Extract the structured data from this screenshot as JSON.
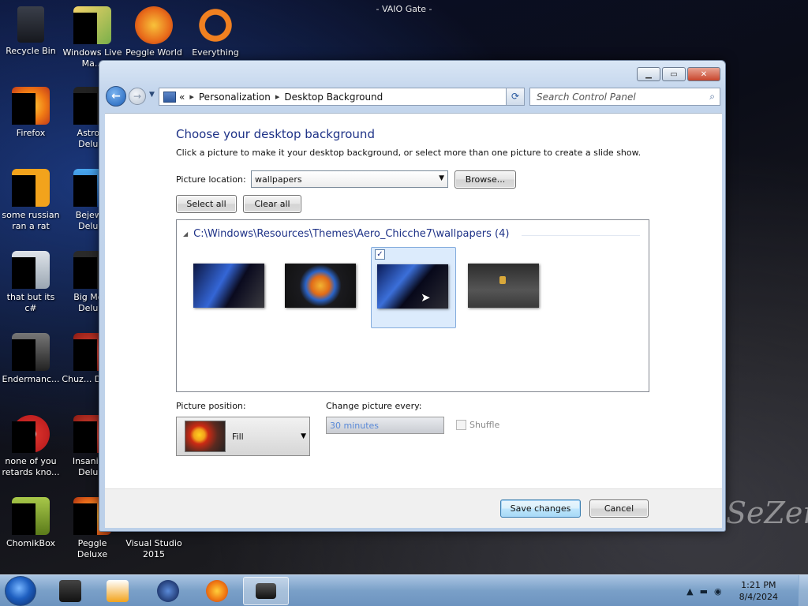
{
  "desktop": {
    "top_title": "- VAIO Gate -",
    "watermark": "SeZen",
    "icons": [
      {
        "label": "Recycle Bin",
        "icon": "recycle-bin-icon",
        "color": "#2b2f3a"
      },
      {
        "label": "Windows Live Ma...",
        "icon": "windows-live-icon",
        "color": "#e4b53c"
      },
      {
        "label": "Peggle World",
        "icon": "peggle-icon",
        "color": "#e86a1a"
      },
      {
        "label": "Everything",
        "icon": "everything-icon",
        "color": "#f08020"
      },
      {
        "label": "Firefox",
        "icon": "firefox-icon",
        "color": "#f07a14"
      },
      {
        "label": "Astro... Delu...",
        "icon": "game-icon",
        "color": "#333"
      },
      {
        "label": "some russian ran a rat",
        "icon": "shortcut-icon",
        "color": "#f2a31c"
      },
      {
        "label": "Bejew... Delu...",
        "icon": "game-icon",
        "color": "#1a6fd0"
      },
      {
        "label": "that but its c#",
        "icon": "copy-icon",
        "color": "#9aa6b2"
      },
      {
        "label": "Big Mo... Delu...",
        "icon": "game-icon",
        "color": "#333"
      },
      {
        "label": "Endermanc...",
        "icon": "app-icon",
        "color": "#555"
      },
      {
        "label": "Chuz... Delu...",
        "icon": "game-icon",
        "color": "#c8281e"
      },
      {
        "label": "none of you retards kno...",
        "icon": "chrome-icon",
        "color": "#d8302a"
      },
      {
        "label": "Insaniq... Delu...",
        "icon": "game-icon",
        "color": "#c8281e"
      },
      {
        "label": "ChomikBox",
        "icon": "chomikbox-icon",
        "color": "#6a8a2a"
      },
      {
        "label": "Peggle Deluxe",
        "icon": "peggle-icon",
        "color": "#e86a1a"
      },
      {
        "label": "Visual Studio 2015",
        "icon": "visual-studio-icon",
        "color": "#6a3ea8"
      }
    ]
  },
  "window": {
    "address": {
      "overflow": "«",
      "crumbs": [
        "Personalization",
        "Desktop Background"
      ]
    },
    "search_placeholder": "Search Control Panel",
    "heading": "Choose your desktop background",
    "description": "Click a picture to make it your desktop background, or select more than one picture to create a slide show.",
    "picture_location_label": "Picture location:",
    "picture_location_value": "wallpapers",
    "browse_label": "Browse...",
    "select_all_label": "Select all",
    "clear_all_label": "Clear all",
    "group_title": "C:\\Windows\\Resources\\Themes\\Aero_Chicche7\\wallpapers (4)",
    "wallpapers": [
      {
        "name": "wallpaper-1",
        "selected": false
      },
      {
        "name": "wallpaper-2",
        "selected": false
      },
      {
        "name": "wallpaper-3",
        "selected": true
      },
      {
        "name": "wallpaper-4",
        "selected": false
      }
    ],
    "picture_position_label": "Picture position:",
    "picture_position_value": "Fill",
    "change_every_label": "Change picture every:",
    "change_every_value": "30 minutes",
    "shuffle_label": "Shuffle",
    "save_label": "Save changes",
    "cancel_label": "Cancel"
  },
  "taskbar": {
    "apps": [
      {
        "name": "file-explorer-icon",
        "color": "#222",
        "active": false
      },
      {
        "name": "media-player-icon",
        "color": "#f2a31c",
        "active": false
      },
      {
        "name": "globe-icon",
        "color": "#1a3a7a",
        "active": false
      },
      {
        "name": "firefox-icon",
        "color": "#f07a14",
        "active": false
      },
      {
        "name": "control-panel-icon",
        "color": "#223",
        "active": true
      }
    ],
    "time": "1:21 PM",
    "date": "8/4/2024"
  }
}
